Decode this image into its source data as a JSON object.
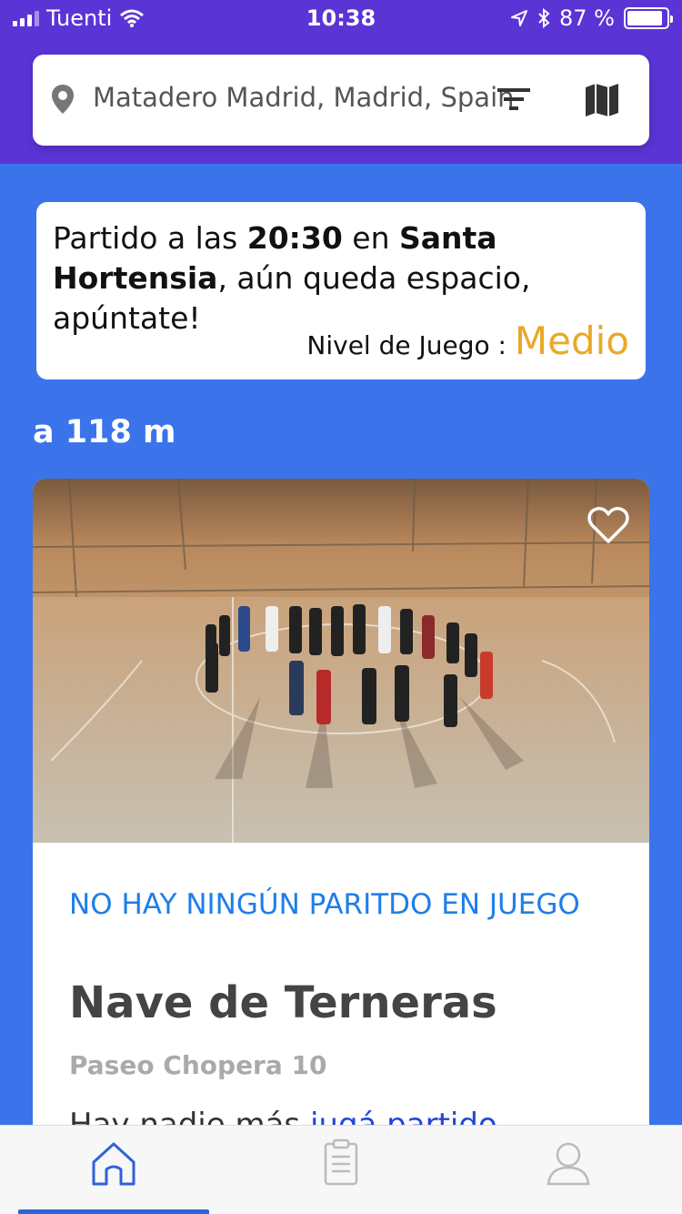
{
  "status_bar": {
    "carrier": "Tuenti",
    "time": "10:38",
    "battery": "87 %"
  },
  "search": {
    "location": "Matadero Madrid, Madrid, Spain"
  },
  "banner": {
    "msg_prefix": "Partido a las ",
    "msg_time": "20:30",
    "msg_mid": " en ",
    "msg_place": "Santa Hortensia",
    "msg_suffix": ", aún queda espacio, apúntate!",
    "level_label": "Nivel de Juego : ",
    "level_value": "Medio"
  },
  "distance": "a 118 m",
  "card": {
    "status": "NO HAY NINGÚN PARITDO EN JUEGO",
    "venue": "Nave de Terneras",
    "address": "Paseo Chopera 10",
    "cutoff_text": "Hay nadie más ",
    "cutoff_link": "jugá partido"
  },
  "colors": {
    "header": "#5b34d6",
    "background": "#3b74ea",
    "level": "#e8a92a",
    "status_text": "#1f7ee8",
    "tab_active": "#2f62d8"
  },
  "icons": {
    "location": "map-pin-icon",
    "filter": "filter-icon",
    "map": "map-icon",
    "favorite": "heart-icon",
    "home": "home-icon",
    "list": "clipboard-icon",
    "profile": "user-icon"
  }
}
